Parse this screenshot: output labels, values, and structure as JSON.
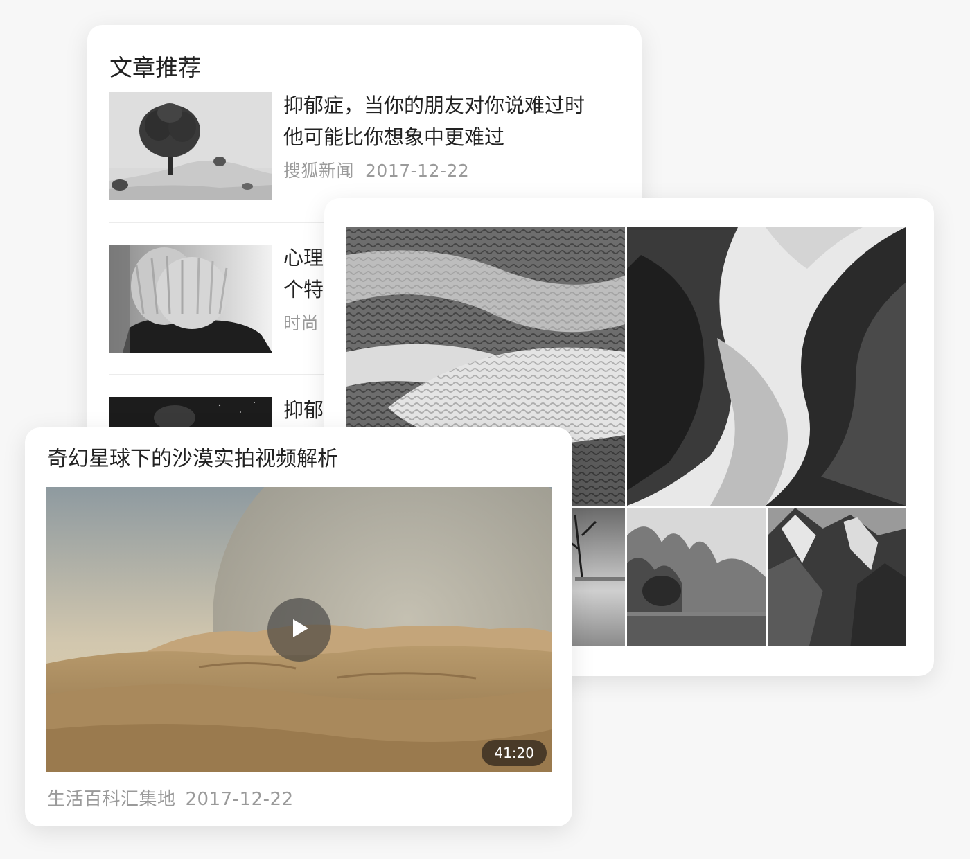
{
  "article_card": {
    "heading": "文章推荐",
    "articles": [
      {
        "title_line1": "抑郁症，当你的朋友对你说难过时",
        "title_line2": "他可能比你想象中更难过",
        "source": "搜狐新闻",
        "date": "2017-12-22"
      },
      {
        "title_line1": "心理",
        "title_line2": "个特",
        "source": "时尚",
        "date": ""
      },
      {
        "title_line1": "抑郁",
        "title_line2": "",
        "source": "",
        "date": ""
      }
    ]
  },
  "video_card": {
    "title": "奇幻星球下的沙漠实拍视频解析",
    "duration": "41:20",
    "source": "生活百科汇集地",
    "date": "2017-12-22"
  },
  "icons": {
    "play": "play-icon"
  },
  "colors": {
    "background": "#f7f7f7",
    "card": "#ffffff",
    "meta_text": "#9a9a9a",
    "title_text": "#222222"
  }
}
